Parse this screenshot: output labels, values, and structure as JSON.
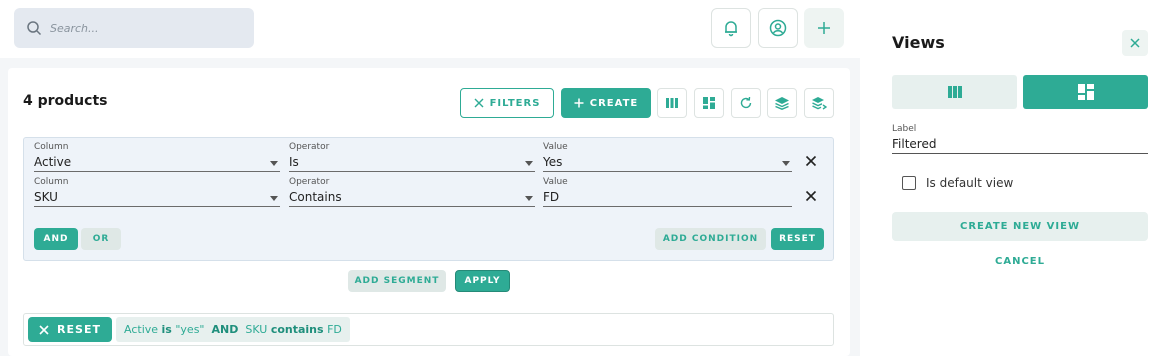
{
  "header": {
    "search_placeholder": "Search...",
    "icons": [
      "bell-icon",
      "user-circle-icon",
      "plus-icon"
    ]
  },
  "list": {
    "title": "4 products",
    "filters_label": "FILTERS",
    "create_label": "CREATE",
    "toolbar_icons": [
      "columns-icon",
      "dashboard-icon",
      "refresh-icon",
      "stack-icon",
      "stack-arrow-icon"
    ]
  },
  "filter": {
    "conditions": [
      {
        "column_label": "Column",
        "column": "Active",
        "operator_label": "Operator",
        "operator": "Is",
        "value_label": "Value",
        "value": "Yes"
      },
      {
        "column_label": "Column",
        "column": "SKU",
        "operator_label": "Operator",
        "operator": "Contains",
        "value_label": "Value",
        "value": "FD"
      }
    ],
    "and_label": "AND",
    "or_label": "OR",
    "add_condition_label": "ADD CONDITION",
    "reset_label": "RESET",
    "add_segment_label": "ADD SEGMENT",
    "apply_label": "APPLY"
  },
  "applied": {
    "reset_label": "RESET",
    "parts": {
      "f1_col": "Active",
      "f1_op": "is",
      "f1_val": "\"yes\"",
      "joiner": "AND",
      "f2_col": "SKU",
      "f2_op": "contains",
      "f2_val": "FD"
    }
  },
  "views_panel": {
    "title": "Views",
    "label_caption": "Label",
    "label_value": "Filtered",
    "default_label": "Is default view",
    "create_label": "CREATE NEW VIEW",
    "cancel_label": "CANCEL"
  },
  "colors": {
    "accent": "#2eab95",
    "accent_light": "#e7f0ee",
    "filter_bg": "#eef3f9"
  }
}
